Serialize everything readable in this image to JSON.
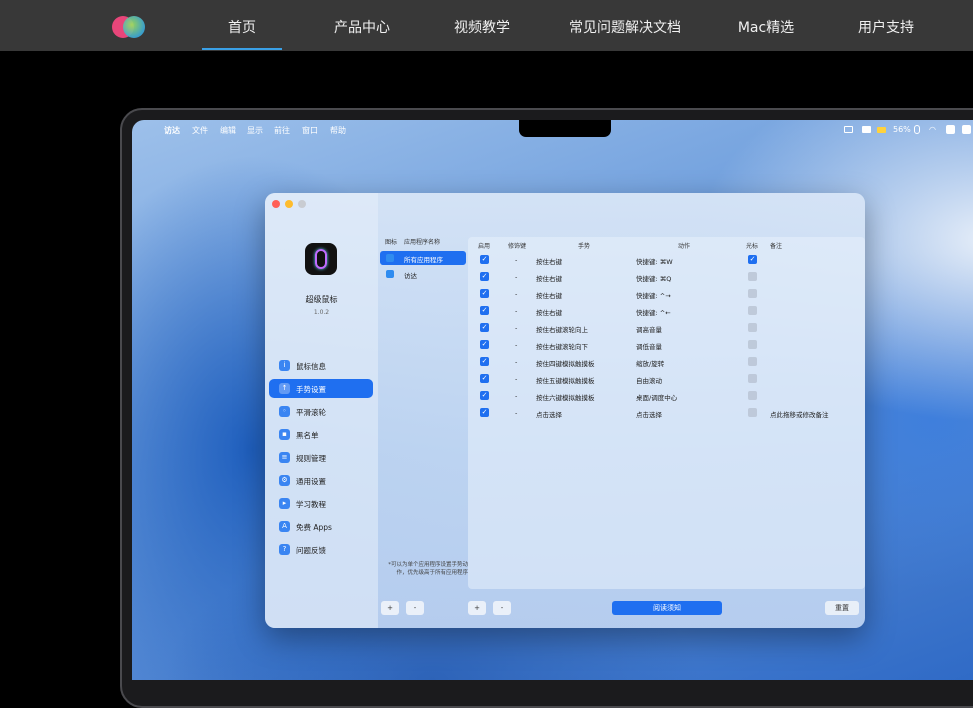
{
  "nav": {
    "items": [
      "首页",
      "产品中心",
      "视频教学",
      "常见问题解决文档",
      "Mac精选",
      "用户支持"
    ],
    "active_index": 0
  },
  "menubar": {
    "app": "访达",
    "items": [
      "文件",
      "编辑",
      "显示",
      "前往",
      "窗口",
      "帮助"
    ],
    "battery": "56%"
  },
  "app": {
    "name": "超级鼠标",
    "version": "1.0.2",
    "sidebar": [
      {
        "label": "鼠标信息",
        "icon": "info-icon"
      },
      {
        "label": "手势设置",
        "icon": "gesture-icon",
        "active": true
      },
      {
        "label": "平滑滚轮",
        "icon": "scroll-icon"
      },
      {
        "label": "黑名单",
        "icon": "blacklist-icon"
      },
      {
        "label": "规则管理",
        "icon": "rules-icon"
      },
      {
        "label": "通用设置",
        "icon": "settings-icon"
      },
      {
        "label": "学习教程",
        "icon": "tutorial-icon"
      },
      {
        "label": "免费 Apps",
        "icon": "apps-icon"
      },
      {
        "label": "问题反馈",
        "icon": "feedback-icon"
      }
    ],
    "app_list": {
      "headers": [
        "图标",
        "应用程序名称"
      ],
      "rows": [
        {
          "name": "所有应用程序",
          "active": true
        },
        {
          "name": "访达"
        }
      ],
      "note": "*可以为单个应用程序设置手势动作，优先级高于所有应用程序"
    },
    "table": {
      "headers": [
        "启用",
        "修饰键",
        "手势",
        "动作",
        "光标",
        "备注"
      ],
      "rows": [
        {
          "enabled": true,
          "modifier": "-",
          "gesture": "按住右键",
          "action": "快捷键: ⌘W",
          "cursor": true,
          "remark": ""
        },
        {
          "enabled": true,
          "modifier": "-",
          "gesture": "按住右键",
          "action": "快捷键: ⌘Q",
          "cursor": false,
          "remark": ""
        },
        {
          "enabled": true,
          "modifier": "-",
          "gesture": "按住右键",
          "action": "快捷键: ^→",
          "cursor": false,
          "remark": ""
        },
        {
          "enabled": true,
          "modifier": "-",
          "gesture": "按住右键",
          "action": "快捷键: ^←",
          "cursor": false,
          "remark": ""
        },
        {
          "enabled": true,
          "modifier": "-",
          "gesture": "按住右键滚轮向上",
          "action": "调高音量",
          "cursor": false,
          "remark": ""
        },
        {
          "enabled": true,
          "modifier": "-",
          "gesture": "按住右键滚轮向下",
          "action": "调低音量",
          "cursor": false,
          "remark": ""
        },
        {
          "enabled": true,
          "modifier": "-",
          "gesture": "按住四键模拟触摸板",
          "action": "缩放/旋转",
          "cursor": false,
          "remark": ""
        },
        {
          "enabled": true,
          "modifier": "-",
          "gesture": "按住五键模拟触摸板",
          "action": "自由滚动",
          "cursor": false,
          "remark": ""
        },
        {
          "enabled": true,
          "modifier": "-",
          "gesture": "按住六键模拟触摸板",
          "action": "桌面/调度中心",
          "cursor": false,
          "remark": ""
        },
        {
          "enabled": true,
          "modifier": "-",
          "gesture": "点击选择",
          "action": "点击选择",
          "cursor": false,
          "remark": "点此拖移或修改备注"
        }
      ]
    },
    "buttons": {
      "add": "+",
      "remove": "-",
      "must_read": "阅读须知",
      "reset": "重置"
    }
  }
}
